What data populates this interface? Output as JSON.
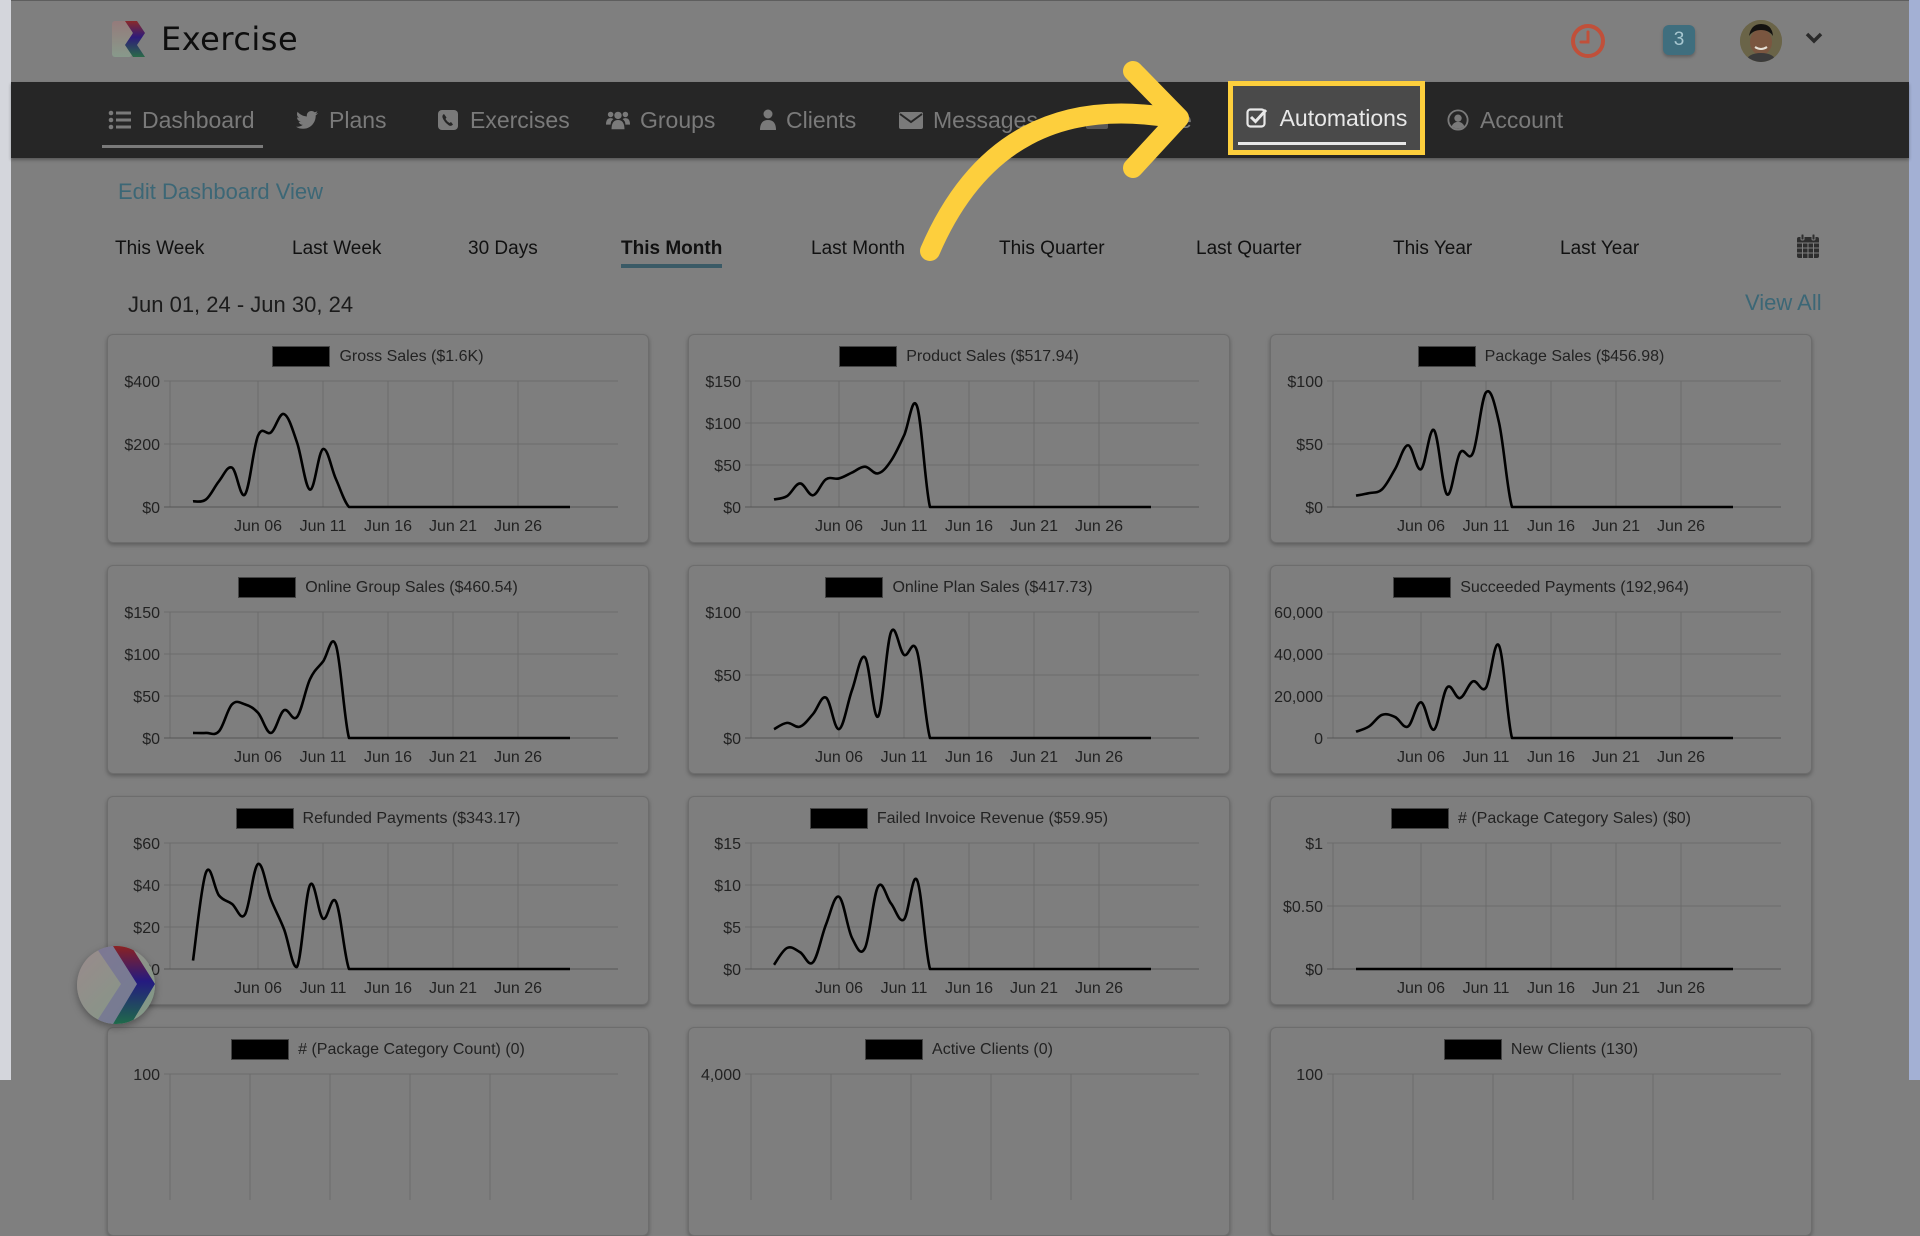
{
  "app": {
    "name": "Exercise",
    "notification_count": "3"
  },
  "nav": {
    "items": [
      {
        "label": "Dashboard",
        "icon": "list-icon"
      },
      {
        "label": "Plans",
        "icon": "twitter-bird-icon"
      },
      {
        "label": "Exercises",
        "icon": "phone-square-icon"
      },
      {
        "label": "Groups",
        "icon": "users-icon"
      },
      {
        "label": "Clients",
        "icon": "user-icon"
      },
      {
        "label": "Messages",
        "icon": "envelope-icon"
      },
      {
        "label": "e",
        "icon": "obscured-icon"
      },
      {
        "label": "Automations",
        "icon": "check-square-icon"
      },
      {
        "label": "Account",
        "icon": "user-circle-icon"
      }
    ],
    "active": "Automations"
  },
  "toolbar": {
    "edit_label": "Edit Dashboard View",
    "ranges": [
      "This Week",
      "Last Week",
      "30 Days",
      "This Month",
      "Last Month",
      "This Quarter",
      "Last Quarter",
      "This Year",
      "Last Year"
    ],
    "active_range": "This Month",
    "date_range": "Jun 01, 24 - Jun 30, 24",
    "view_all": "View All"
  },
  "colors": {
    "highlight": "#fdcf3d",
    "link": "#3c6776",
    "nav_bg": "#262626",
    "clock": "#c0503a",
    "badge": "#3f6e7e"
  },
  "chart_data": [
    {
      "type": "line",
      "title": "Gross Sales ($1.6K)",
      "ylim": [
        0,
        400
      ],
      "yticks": [
        "$0",
        "$200",
        "$400"
      ],
      "ytick_values": [
        0,
        200,
        400
      ],
      "xticks": [
        "Jun 06",
        "Jun 11",
        "Jun 16",
        "Jun 21",
        "Jun 26"
      ],
      "x_start": "Jun 01",
      "x_end": "Jun 30",
      "values": [
        18,
        24,
        82,
        125,
        40,
        226,
        237,
        295,
        205,
        55,
        184,
        88,
        0,
        0,
        0,
        0,
        0,
        0,
        0,
        0,
        0,
        0,
        0,
        0,
        0,
        0,
        0,
        0,
        0,
        0
      ]
    },
    {
      "type": "line",
      "title": "Product Sales ($517.94)",
      "ylim": [
        0,
        150
      ],
      "yticks": [
        "$0",
        "$50",
        "$100",
        "$150"
      ],
      "ytick_values": [
        0,
        50,
        100,
        150
      ],
      "xticks": [
        "Jun 06",
        "Jun 11",
        "Jun 16",
        "Jun 21",
        "Jun 26"
      ],
      "x_start": "Jun 01",
      "x_end": "Jun 30",
      "values": [
        9,
        13,
        28,
        14,
        33,
        34,
        41,
        48,
        40,
        55,
        85,
        120,
        0,
        0,
        0,
        0,
        0,
        0,
        0,
        0,
        0,
        0,
        0,
        0,
        0,
        0,
        0,
        0,
        0,
        0
      ]
    },
    {
      "type": "line",
      "title": "Package Sales ($456.98)",
      "ylim": [
        0,
        100
      ],
      "yticks": [
        "$0",
        "$50",
        "$100"
      ],
      "ytick_values": [
        0,
        50,
        100
      ],
      "xticks": [
        "Jun 06",
        "Jun 11",
        "Jun 16",
        "Jun 21",
        "Jun 26"
      ],
      "x_start": "Jun 01",
      "x_end": "Jun 30",
      "values": [
        9,
        11,
        14,
        30,
        49,
        30,
        61,
        10,
        43,
        43,
        91,
        67,
        0,
        0,
        0,
        0,
        0,
        0,
        0,
        0,
        0,
        0,
        0,
        0,
        0,
        0,
        0,
        0,
        0,
        0
      ]
    },
    {
      "type": "line",
      "title": "Online Group Sales ($460.54)",
      "ylim": [
        0,
        150
      ],
      "yticks": [
        "$0",
        "$50",
        "$100",
        "$150"
      ],
      "ytick_values": [
        0,
        50,
        100,
        150
      ],
      "xticks": [
        "Jun 06",
        "Jun 11",
        "Jun 16",
        "Jun 21",
        "Jun 26"
      ],
      "x_start": "Jun 01",
      "x_end": "Jun 30",
      "values": [
        6,
        6,
        8,
        40,
        40,
        30,
        6,
        33,
        25,
        70,
        91,
        110,
        0,
        0,
        0,
        0,
        0,
        0,
        0,
        0,
        0,
        0,
        0,
        0,
        0,
        0,
        0,
        0,
        0,
        0
      ]
    },
    {
      "type": "line",
      "title": "Online Plan Sales ($417.73)",
      "ylim": [
        0,
        100
      ],
      "yticks": [
        "$0",
        "$50",
        "$100"
      ],
      "ytick_values": [
        0,
        50,
        100
      ],
      "xticks": [
        "Jun 06",
        "Jun 11",
        "Jun 16",
        "Jun 21",
        "Jun 26"
      ],
      "x_start": "Jun 01",
      "x_end": "Jun 30",
      "values": [
        7,
        12,
        9,
        19,
        32,
        7,
        38,
        64,
        17,
        84,
        66,
        69,
        0,
        0,
        0,
        0,
        0,
        0,
        0,
        0,
        0,
        0,
        0,
        0,
        0,
        0,
        0,
        0,
        0,
        0
      ]
    },
    {
      "type": "line",
      "title": "Succeeded Payments (192,964)",
      "ylim": [
        0,
        60000
      ],
      "yticks": [
        "0",
        "20,000",
        "40,000",
        "60,000"
      ],
      "ytick_values": [
        0,
        20000,
        40000,
        60000
      ],
      "xticks": [
        "Jun 06",
        "Jun 11",
        "Jun 16",
        "Jun 21",
        "Jun 26"
      ],
      "x_start": "Jun 01",
      "x_end": "Jun 30",
      "values": [
        3000,
        5500,
        11000,
        10000,
        5500,
        17000,
        4000,
        24000,
        19000,
        27000,
        24000,
        44000,
        0,
        0,
        0,
        0,
        0,
        0,
        0,
        0,
        0,
        0,
        0,
        0,
        0,
        0,
        0,
        0,
        0,
        0
      ]
    },
    {
      "type": "line",
      "title": "Refunded Payments ($343.17)",
      "ylim": [
        0,
        60
      ],
      "yticks": [
        "$0",
        "$20",
        "$40",
        "$60"
      ],
      "ytick_values": [
        0,
        20,
        40,
        60
      ],
      "xticks": [
        "Jun 06",
        "Jun 11",
        "Jun 16",
        "Jun 21",
        "Jun 26"
      ],
      "x_start": "Jun 01",
      "x_end": "Jun 30",
      "values": [
        4,
        46,
        35,
        31,
        26,
        50,
        33,
        19,
        1,
        40,
        24,
        32,
        0,
        0,
        0,
        0,
        0,
        0,
        0,
        0,
        0,
        0,
        0,
        0,
        0,
        0,
        0,
        0,
        0,
        0
      ]
    },
    {
      "type": "line",
      "title": "Failed Invoice Revenue ($59.95)",
      "ylim": [
        0,
        15
      ],
      "yticks": [
        "$0",
        "$5",
        "$10",
        "$15"
      ],
      "ytick_values": [
        0,
        5,
        10,
        15
      ],
      "xticks": [
        "Jun 06",
        "Jun 11",
        "Jun 16",
        "Jun 21",
        "Jun 26"
      ],
      "x_start": "Jun 01",
      "x_end": "Jun 30",
      "values": [
        0.5,
        2.5,
        2,
        0.8,
        5.3,
        8.6,
        3.7,
        2.5,
        9.8,
        7.8,
        5.9,
        10.6,
        0,
        0,
        0,
        0,
        0,
        0,
        0,
        0,
        0,
        0,
        0,
        0,
        0,
        0,
        0,
        0,
        0,
        0
      ]
    },
    {
      "type": "line",
      "title": "# (Package Category Sales) ($0)",
      "ylim": [
        0,
        1
      ],
      "yticks": [
        "$0",
        "$0.50",
        "$1"
      ],
      "ytick_values": [
        0,
        0.5,
        1
      ],
      "xticks": [
        "Jun 06",
        "Jun 11",
        "Jun 16",
        "Jun 21",
        "Jun 26"
      ],
      "x_start": "Jun 01",
      "x_end": "Jun 30",
      "values": [
        0,
        0,
        0,
        0,
        0,
        0,
        0,
        0,
        0,
        0,
        0,
        0,
        0,
        0,
        0,
        0,
        0,
        0,
        0,
        0,
        0,
        0,
        0,
        0,
        0,
        0,
        0,
        0,
        0,
        0
      ]
    },
    {
      "type": "line",
      "title": "# (Package Category Count) (0)",
      "ylim": [
        0,
        100
      ],
      "yticks": [
        "100"
      ],
      "ytick_values": [
        100
      ],
      "xticks": [],
      "x_start": "Jun 01",
      "x_end": "Jun 30",
      "values": []
    },
    {
      "type": "line",
      "title": "Active Clients (0)",
      "ylim": [
        0,
        4000
      ],
      "yticks": [
        "4,000"
      ],
      "ytick_values": [
        4000
      ],
      "xticks": [],
      "x_start": "Jun 01",
      "x_end": "Jun 30",
      "values": []
    },
    {
      "type": "line",
      "title": "New Clients (130)",
      "ylim": [
        0,
        100
      ],
      "yticks": [
        "100"
      ],
      "ytick_values": [
        100
      ],
      "xticks": [],
      "x_start": "Jun 01",
      "x_end": "Jun 30",
      "values": []
    }
  ]
}
